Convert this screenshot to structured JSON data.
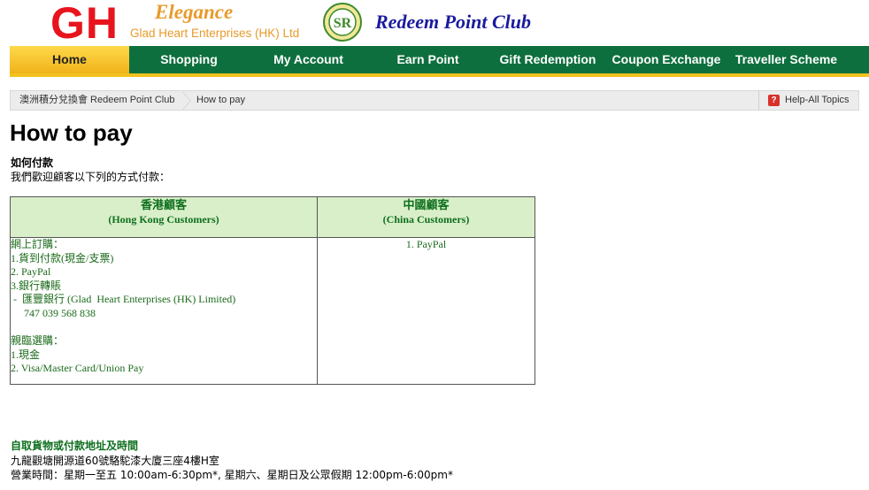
{
  "header": {
    "logo_gh": "GH",
    "logo_elegance": "Elegance",
    "company": "Glad Heart Enterprises (HK) Ltd",
    "sr_logo": "SR",
    "club_title": "Redeem Point Club"
  },
  "nav": {
    "items": [
      {
        "label": "Home"
      },
      {
        "label": "Shopping"
      },
      {
        "label": "My Account"
      },
      {
        "label": "Earn Point"
      },
      {
        "label": "Gift Redemption"
      },
      {
        "label": "Coupon Exchange"
      },
      {
        "label": "Traveller Scheme"
      }
    ]
  },
  "breadcrumb": {
    "home": "澳洲積分兌換會 Redeem Point Club",
    "current": "How to pay",
    "help_icon": "?",
    "help": "Help-All Topics"
  },
  "page": {
    "title": "How to pay",
    "sub_head": "如何付款",
    "sub_intro": "我們歡迎顧客以下列的方式付款："
  },
  "table": {
    "hk_zh": "香港顧客",
    "hk_en": "(Hong Kong Customers)",
    "cn_zh": "中國顧客",
    "cn_en": "(China Customers)",
    "hk_lines": [
      "網上訂購：",
      "1.貨到付款(現金/支票)",
      "2. PayPal",
      "3.銀行轉賬",
      " -  匯豐銀行 (Glad  Heart Enterprises (HK) Limited)",
      "     747 039 568 838",
      "",
      "親臨選購：",
      "1.現金",
      "2. Visa/Master Card/Union Pay"
    ],
    "cn_line": "1. PayPal"
  },
  "pickup": {
    "title": "自取貨物或付款地址及時間",
    "address": "九龍觀塘開源道60號駱駝漆大廈三座4樓H室",
    "hours": "營業時間：星期一至五 10:00am-6:30pm*, 星期六、星期日及公眾假期 12:00pm-6:00pm*"
  }
}
